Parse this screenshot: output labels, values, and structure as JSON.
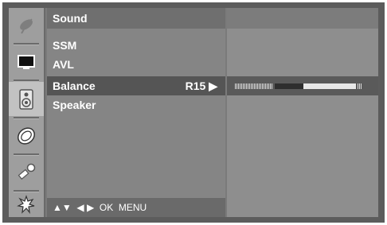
{
  "menu": {
    "title": "Sound",
    "items": [
      {
        "label": "SSM",
        "value": ""
      },
      {
        "label": "AVL",
        "value": ""
      },
      {
        "label": "Balance",
        "value": "R15 ▶",
        "selected": true
      },
      {
        "label": "Speaker",
        "value": ""
      }
    ],
    "nav_hint": "▲▼  ◀ ▶  OK  MENU"
  },
  "icons": [
    "satellite-dish-icon",
    "screen-icon",
    "speaker-icon",
    "clock-icon",
    "key-icon",
    "option-icon"
  ],
  "selected_icon": "speaker-icon",
  "balance": {
    "value": 15,
    "side": "R",
    "range": [
      -50,
      50
    ]
  },
  "colors": {
    "selection": "#555555",
    "text": "#ffffff"
  }
}
